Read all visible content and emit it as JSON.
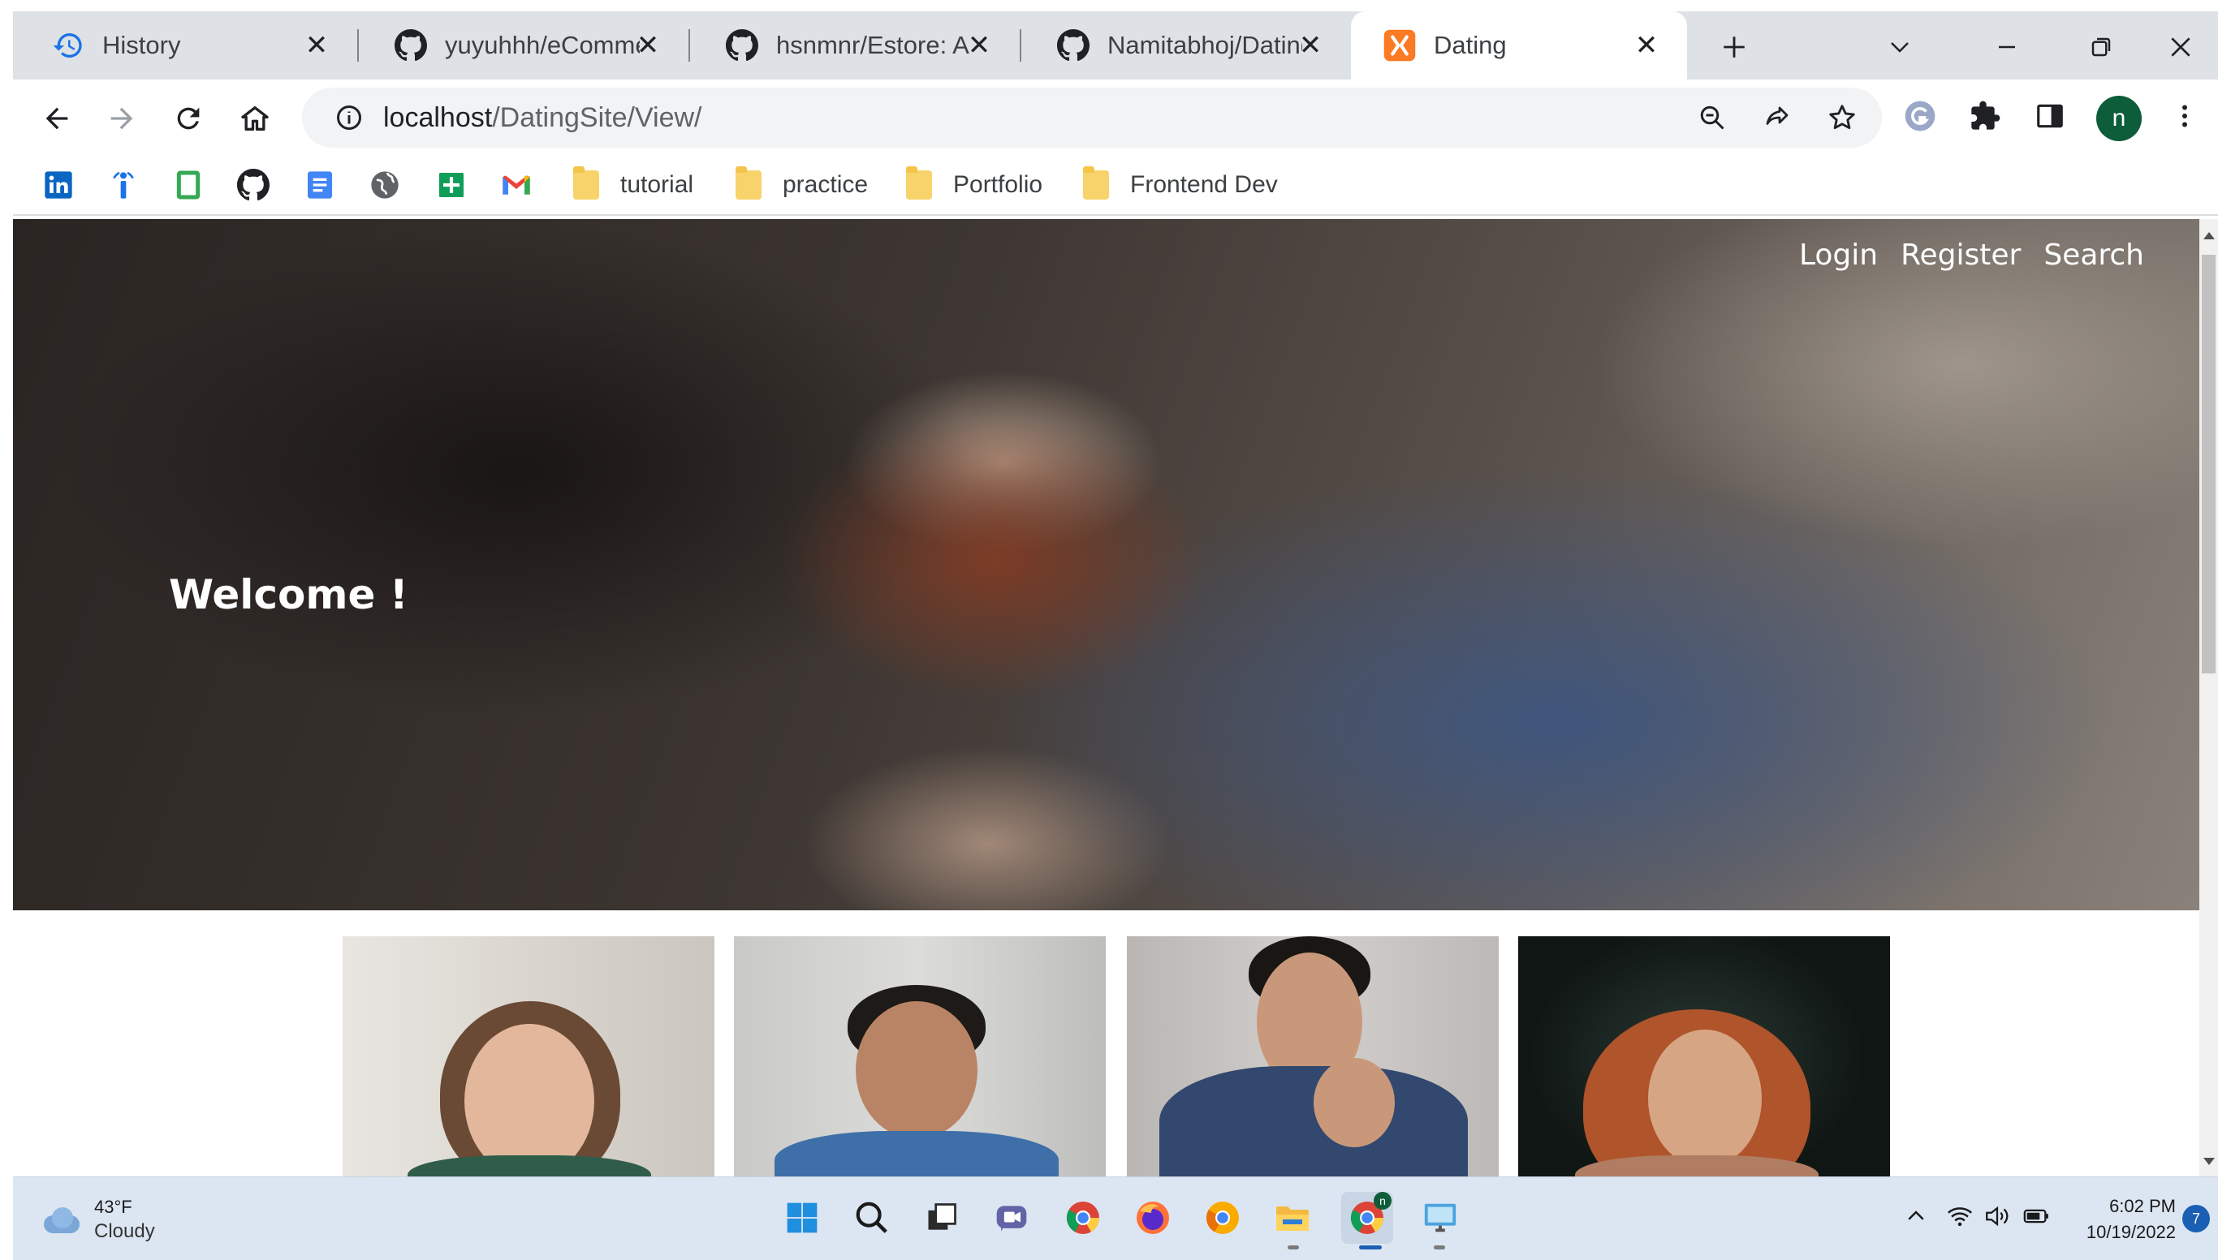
{
  "browser": {
    "tabs": [
      {
        "title": "History",
        "icon": "history-icon",
        "active": false
      },
      {
        "title": "yuyuhhh/eCommerce",
        "icon": "github-icon",
        "active": false
      },
      {
        "title": "hsnmnr/Estore: A",
        "icon": "github-icon",
        "active": false
      },
      {
        "title": "Namitabhoj/Dating",
        "icon": "github-icon",
        "active": false
      },
      {
        "title": "Dating",
        "icon": "xampp-icon",
        "active": true
      }
    ],
    "url_host": "localhost",
    "url_path": "/DatingSite/View/",
    "profile_initial": "n",
    "bookmarks": {
      "icons": [
        "linkedin-icon",
        "info-icon",
        "green-doc-icon",
        "github-icon",
        "google-docs-icon",
        "globe-icon",
        "google-sheets-icon",
        "gmail-icon"
      ],
      "folders": [
        "tutorial",
        "practice",
        "Portfolio",
        "Frontend Dev"
      ]
    }
  },
  "page": {
    "nav": [
      "Login",
      "Register",
      "Search"
    ],
    "welcome": "Welcome !"
  },
  "taskbar": {
    "temperature": "43°F",
    "condition": "Cloudy",
    "time": "6:02 PM",
    "date": "10/19/2022",
    "notifications": "7",
    "chrome_badge": "n"
  },
  "colors": {
    "tabstrip": "#dee1e6",
    "omnibox": "#f1f3f4",
    "profile": "#0d5c3a",
    "taskbar": "#dce6f2",
    "accent": "#1a73e8"
  }
}
